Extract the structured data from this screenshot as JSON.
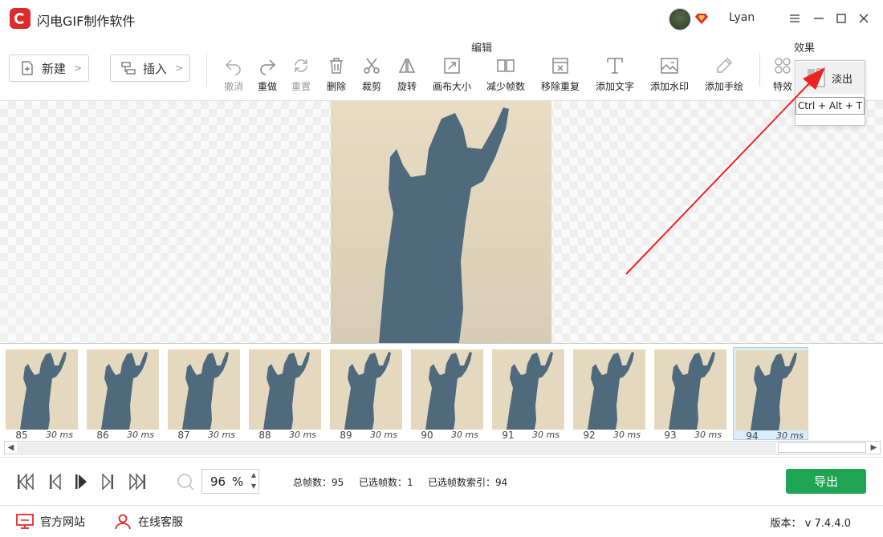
{
  "app": {
    "title": "闪电GIF制作软件",
    "brand_color": "#e02a2a"
  },
  "user": {
    "name": "Lyan"
  },
  "toolbar": {
    "new_label": "新建",
    "insert_label": "插入",
    "edit_group_label": "编辑",
    "effects_group_label": "效果",
    "tools": [
      {
        "label": "撤消",
        "icon": "undo-icon",
        "enabled": false
      },
      {
        "label": "重做",
        "icon": "redo-icon",
        "enabled": true
      },
      {
        "label": "重置",
        "icon": "reset-icon",
        "enabled": false
      },
      {
        "label": "删除",
        "icon": "trash-icon",
        "enabled": true
      },
      {
        "label": "裁剪",
        "icon": "scissors-icon",
        "enabled": true
      },
      {
        "label": "旋转",
        "icon": "rotate-icon",
        "enabled": true
      },
      {
        "label": "画布大小",
        "icon": "canvas-size-icon",
        "enabled": true
      },
      {
        "label": "减少帧数",
        "icon": "reduce-frames-icon",
        "enabled": true
      },
      {
        "label": "移除重复",
        "icon": "remove-duplicate-icon",
        "enabled": true
      },
      {
        "label": "添加文字",
        "icon": "text-icon",
        "enabled": true
      },
      {
        "label": "添加水印",
        "icon": "watermark-icon",
        "enabled": true
      },
      {
        "label": "添加手绘",
        "icon": "pen-icon",
        "enabled": true
      }
    ],
    "effects_label": "特效"
  },
  "popup": {
    "item_label": "淡出",
    "shortcut": "Ctrl + Alt + T"
  },
  "frames": [
    {
      "num": "85",
      "delay": "30 ms"
    },
    {
      "num": "86",
      "delay": "30 ms"
    },
    {
      "num": "87",
      "delay": "30 ms"
    },
    {
      "num": "88",
      "delay": "30 ms"
    },
    {
      "num": "89",
      "delay": "30 ms"
    },
    {
      "num": "90",
      "delay": "30 ms"
    },
    {
      "num": "91",
      "delay": "30 ms"
    },
    {
      "num": "92",
      "delay": "30 ms"
    },
    {
      "num": "93",
      "delay": "30 ms"
    },
    {
      "num": "94",
      "delay": "30 ms"
    }
  ],
  "selected_frame": "94",
  "playback": {
    "zoom_value": "96",
    "zoom_unit": "%",
    "total_frames_label": "总帧数：95",
    "selected_count_label": "已选帧数：1",
    "selected_index_label": "已选帧数索引：94",
    "export_label": "导出"
  },
  "footer": {
    "website_label": "官方网站",
    "support_label": "在线客服",
    "version_label": "版本： v 7.4.4.0"
  },
  "colors": {
    "export_green": "#1fa453",
    "accent_red": "#e02a2a"
  }
}
